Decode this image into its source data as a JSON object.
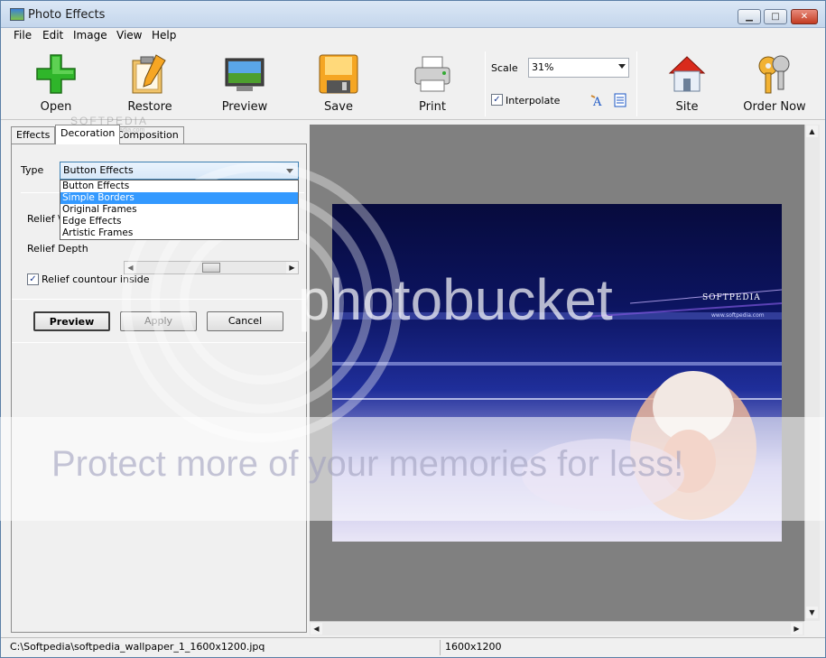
{
  "window": {
    "title": "Photo Effects",
    "min_glyph": "▁",
    "max_glyph": "□",
    "close_glyph": "✕"
  },
  "menu": [
    "File",
    "Edit",
    "Image",
    "View",
    "Help"
  ],
  "toolbar": {
    "open": "Open",
    "restore": "Restore",
    "preview": "Preview",
    "save": "Save",
    "print": "Print",
    "site": "Site",
    "order": "Order Now",
    "scale_label": "Scale",
    "scale_value": "31%",
    "interpolate_label": "Interpolate",
    "interpolate_checked": true
  },
  "left_panel": {
    "tabs": [
      "Effects",
      "Decoration",
      "Composition"
    ],
    "active_tab": "Decoration",
    "type_label": "Type",
    "type_value": "Button Effects",
    "type_options": [
      "Button Effects",
      "Simple Borders",
      "Original Frames",
      "Edge Effects",
      "Artistic Frames"
    ],
    "highlighted_option": "Simple Borders",
    "relief_label_partial": "Relief \\",
    "relief_depth_label": "Relief Depth",
    "relief_depth_value": 0.5,
    "relief_inside_label": "Relief countour inside",
    "relief_inside_checked": true,
    "buttons": {
      "preview": "Preview",
      "apply": "Apply",
      "cancel": "Cancel"
    }
  },
  "canvas": {
    "photo_brand": "SOFTPEDIA",
    "photo_tagline": "www.softpedia.com"
  },
  "watermark": {
    "logo_text": "photobucket",
    "tagline": "Protect more of your memories for less!",
    "corner_text": "SOFTPEDIA",
    "corner_sub": "www.softpedia.com"
  },
  "status": {
    "path": "C:\\Softpedia\\softpedia_wallpaper_1_1600x1200.jpq",
    "dimensions": "1600x1200"
  },
  "colors": {
    "accent": "#3399ff",
    "canvas_bg": "#808080"
  }
}
